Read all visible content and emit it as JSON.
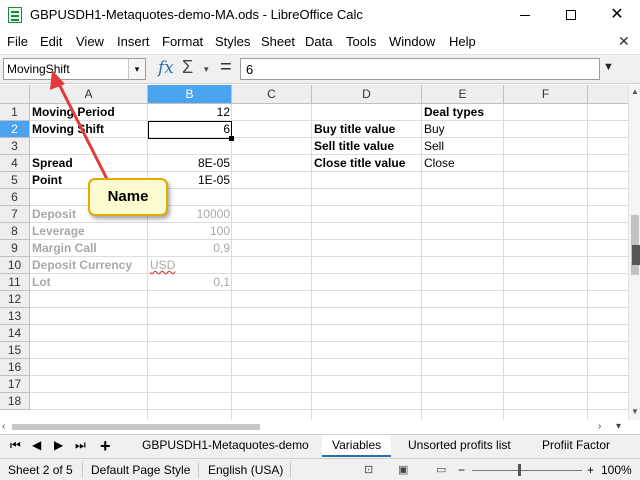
{
  "window": {
    "title": "GBPUSDH1-Metaquotes-demo-MA.ods - LibreOffice Calc",
    "close_glyph": "✕"
  },
  "menu": {
    "items": [
      "File",
      "Edit",
      "View",
      "Insert",
      "Format",
      "Styles",
      "Sheet",
      "Data",
      "Tools",
      "Window",
      "Help"
    ],
    "close_glyph": "✕"
  },
  "formula_bar": {
    "name_box": "MovingShift",
    "fx_label": "fx",
    "sum_label": "Σ",
    "equals_label": "=",
    "content": "6"
  },
  "grid": {
    "columns": [
      "A",
      "B",
      "C",
      "D",
      "E",
      "F"
    ],
    "active_column": "B",
    "rows": [
      "1",
      "2",
      "3",
      "4",
      "5",
      "6",
      "7",
      "8",
      "9",
      "10",
      "11",
      "12",
      "13",
      "14",
      "15",
      "16",
      "17",
      "18"
    ],
    "active_row": "2",
    "cells": {
      "A1": "Moving Period",
      "B1": "12",
      "A2": "Moving Shift",
      "B2": "6",
      "A4": "Spread",
      "B4": "8E-05",
      "A5": "Point",
      "B5": "1E-05",
      "A7": "Deposit",
      "B7": "10000",
      "A8": "Leverage",
      "B8": "100",
      "A9": "Margin Call",
      "B9": "0,9",
      "A10": "Deposit Currency",
      "B10": "USD",
      "A11": "Lot",
      "B11": "0,1",
      "E1": "Deal types",
      "D2": "Buy title value",
      "E2": "Buy",
      "D3": "Sell title value",
      "E3": "Sell",
      "D4": "Close title value",
      "E4": "Close"
    }
  },
  "callout": {
    "label": "Name"
  },
  "sheet_tabs": {
    "tabs": [
      "GBPUSDH1-Metaquotes-demo",
      "Variables",
      "Unsorted profits list",
      "Profiit Factor"
    ],
    "active": "Variables"
  },
  "status": {
    "sheet": "Sheet 2 of 5",
    "page_style": "Default Page Style",
    "language": "English (USA)",
    "zoom": "100%",
    "zoom_minus": "−",
    "zoom_plus": "+"
  },
  "colors": {
    "header_active": "#4aa3ee",
    "callout_fill": "#fffbd0",
    "callout_border": "#e2a900",
    "arrow": "#e23a3a"
  }
}
